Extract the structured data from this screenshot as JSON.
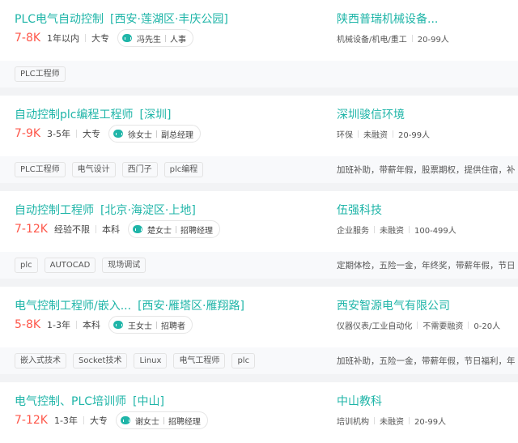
{
  "jobs": [
    {
      "title": "PLC电气自动控制",
      "location": "[西安·莲湖区·丰庆公园]",
      "salary": "7-8K",
      "experience": "1年以内",
      "education": "大专",
      "recruiter_name": "冯先生",
      "recruiter_title": "人事",
      "company": "陕西普瑞机械设备...",
      "industry": "机械设备/机电/重工",
      "funding": "",
      "size": "20-99人",
      "tags": [
        "PLC工程师"
      ],
      "benefits": ""
    },
    {
      "title": "自动控制plc编程工程师",
      "location": "[深圳]",
      "salary": "7-9K",
      "experience": "3-5年",
      "education": "大专",
      "recruiter_name": "徐女士",
      "recruiter_title": "副总经理",
      "company": "深圳骏信环境",
      "industry": "环保",
      "funding": "未融资",
      "size": "20-99人",
      "tags": [
        "PLC工程师",
        "电气设计",
        "西门子",
        "plc编程"
      ],
      "benefits": "加班补助，带薪年假，股票期权，提供住宿，补"
    },
    {
      "title": "自动控制工程师",
      "location": "[北京·海淀区·上地]",
      "salary": "7-12K",
      "experience": "经验不限",
      "education": "本科",
      "recruiter_name": "楚女士",
      "recruiter_title": "招聘经理",
      "company": "伍强科技",
      "industry": "企业服务",
      "funding": "未融资",
      "size": "100-499人",
      "tags": [
        "plc",
        "AUTOCAD",
        "现场调试"
      ],
      "benefits": "定期体检，五险一金，年终奖，带薪年假，节日"
    },
    {
      "title": "电气控制工程师/嵌入...",
      "location": "[西安·雁塔区·雁翔路]",
      "salary": "5-8K",
      "experience": "1-3年",
      "education": "本科",
      "recruiter_name": "王女士",
      "recruiter_title": "招聘者",
      "company": "西安智源电气有限公司",
      "industry": "仪器仪表/工业自动化",
      "funding": "不需要融资",
      "size": "0-20人",
      "tags": [
        "嵌入式技术",
        "Socket技术",
        "Linux",
        "电气工程师",
        "plc"
      ],
      "benefits": "加班补助，五险一金，带薪年假，节日福利，年"
    },
    {
      "title": "电气控制、PLC培训师",
      "location": "[中山]",
      "salary": "7-12K",
      "experience": "1-3年",
      "education": "大专",
      "recruiter_name": "谢女士",
      "recruiter_title": "招聘经理",
      "company": "中山教科",
      "industry": "培训机构",
      "funding": "未融资",
      "size": "20-99人",
      "tags": [],
      "benefits": ""
    }
  ]
}
